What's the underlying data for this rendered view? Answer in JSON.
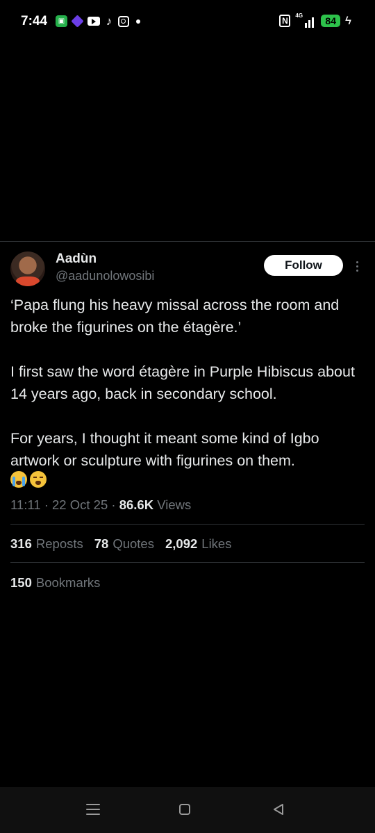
{
  "status_bar": {
    "time": "7:44",
    "network": "4G",
    "battery": "84",
    "icons": [
      "app-icon",
      "proton-vpn-icon",
      "youtube-icon",
      "tiktok-icon",
      "instagram-icon",
      "dot-icon",
      "nfc-icon",
      "signal-icon",
      "battery-icon",
      "charging-icon"
    ]
  },
  "tweet": {
    "display_name": "Aadùn",
    "handle": "@aadunolowosibi",
    "follow_label": "Follow",
    "paragraphs": [
      "‘Papa flung his heavy missal across the room and broke the figurines on the étagère.’",
      "I first saw the word étagère in Purple Hibiscus about 14 years ago, back in secondary school.",
      "For years, I thought it meant some kind of Igbo artwork or sculpture with figurines on them."
    ],
    "emojis": [
      "crying-face-icon",
      "weary-face-icon"
    ],
    "time": "11:11",
    "date": "22 Oct 25",
    "views_count": "86.6K",
    "views_label": "Views",
    "reposts_count": "316",
    "reposts_label": "Reposts",
    "quotes_count": "78",
    "quotes_label": "Quotes",
    "likes_count": "2,092",
    "likes_label": "Likes",
    "bookmarks_count": "150",
    "bookmarks_label": "Bookmarks"
  },
  "colors": {
    "background": "#000000",
    "text": "#e7e9ea",
    "secondary_text": "#71767b",
    "divider": "#2f3336",
    "battery": "#2dc24b"
  }
}
